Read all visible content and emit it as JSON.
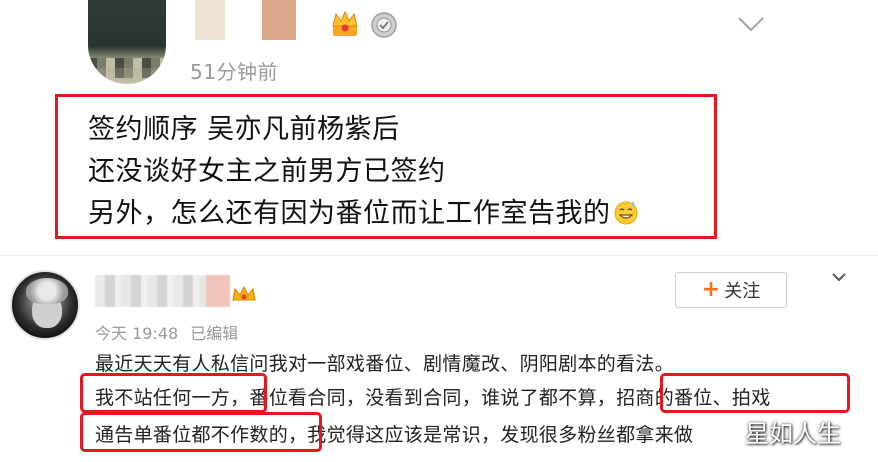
{
  "top_comment": {
    "timestamp": "51分钟前",
    "lines": [
      "签约顺序  吴亦凡前杨紫后",
      "还没谈好女主之前男方已签约",
      "另外，怎么还有因为番位而让工作室告我的"
    ]
  },
  "post": {
    "follow_label": "关注",
    "follow_plus": "+",
    "time": "今天 19:48",
    "edited": "已编辑",
    "body": [
      "最近天天有人私信问我对一部戏番位、剧情魔改、阴阳剧本的看法。",
      "我不站任何一方，番位看合同，没看到合同，谁说了都不算，招商的番位、拍戏",
      "通告单番位都不作数的，我觉得这应该是常识，发现很多粉丝都拿来做"
    ]
  },
  "watermark": "星如人生",
  "icons": {
    "crown_badge": "crown-icon",
    "member_badge": "medal-icon",
    "expand_top": "chevron-down-icon",
    "vip": "vip-crown-icon",
    "expand_post": "chevron-down-icon"
  },
  "colors": {
    "highlight": "#e8161d",
    "meta_gray": "#999999",
    "follow_plus": "#f76f1a"
  }
}
